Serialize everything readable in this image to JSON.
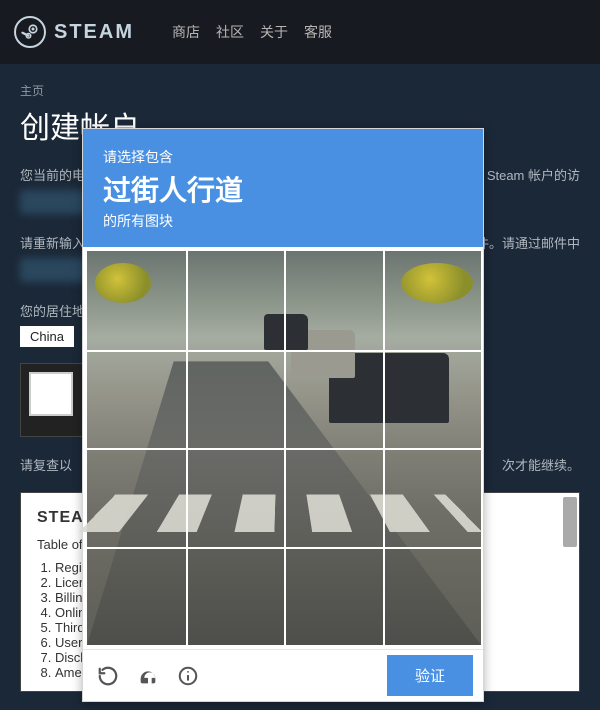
{
  "header": {
    "brand": "STEAM",
    "nav": [
      "商店",
      "社区",
      "关于",
      "客服"
    ]
  },
  "breadcrumb": "主页",
  "page_title": "创建帐户",
  "form": {
    "email_label": "您当前的电",
    "email_suffix": "管理对 Steam 帐户的访",
    "reemail_label": "请重新输入",
    "reemail_suffix": "子邮件。请通过邮件中",
    "country_label": "您的居住地",
    "country_value": "China"
  },
  "review_text": "请复查以",
  "review_suffix": "次才能继续。",
  "agreement": {
    "title_prefix": "STEA",
    "toc_label": "Table of",
    "items": [
      "Regis",
      "Licen",
      "Billing",
      "Onlin",
      "Third",
      "User",
      "Discla",
      "Amendments to this agreement"
    ]
  },
  "captcha": {
    "line1": "请选择包含",
    "line2": "过街人行道",
    "line3": "的所有图块",
    "verify": "验证",
    "icons": {
      "refresh": "refresh-icon",
      "audio": "audio-icon",
      "info": "info-icon"
    }
  }
}
